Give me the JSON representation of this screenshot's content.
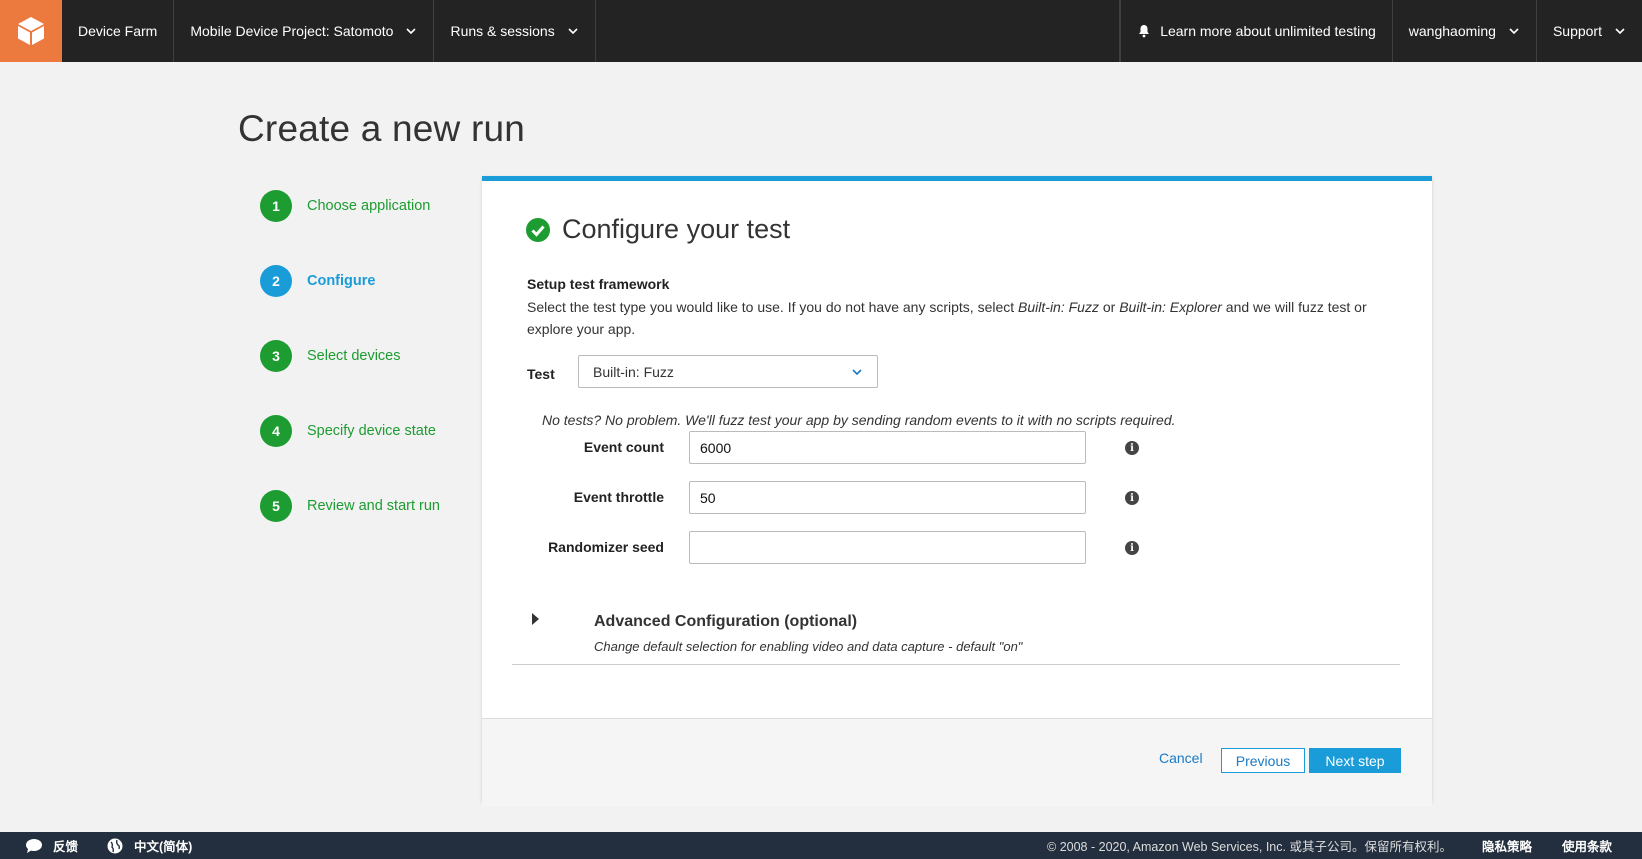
{
  "nav": {
    "brand": "Device Farm",
    "project": "Mobile Device Project: Satomoto",
    "runs": "Runs & sessions",
    "learn_more": "Learn more about unlimited testing",
    "user": "wanghaoming",
    "support": "Support",
    "logo_color": "#ec7a3f"
  },
  "page": {
    "title": "Create a new run"
  },
  "steps": [
    {
      "num": "1",
      "label": "Choose application",
      "state": "done"
    },
    {
      "num": "2",
      "label": "Configure",
      "state": "active"
    },
    {
      "num": "3",
      "label": "Select devices",
      "state": "done"
    },
    {
      "num": "4",
      "label": "Specify device state",
      "state": "done"
    },
    {
      "num": "5",
      "label": "Review and start run",
      "state": "done"
    }
  ],
  "card": {
    "title": "Configure your test",
    "setup_title": "Setup test framework",
    "setup_desc_1": "Select the test type you would like to use. If you do not have any scripts, select ",
    "setup_desc_fuzz": "Built-in: Fuzz",
    "setup_desc_or": " or ",
    "setup_desc_explorer": "Built-in: Explorer",
    "setup_desc_2": " and we will fuzz test or explore your app.",
    "test_label": "Test",
    "test_value": "Built-in: Fuzz",
    "fuzz_note": "No tests? No problem. We'll fuzz test your app by sending random events to it with no scripts required.",
    "fields": {
      "event_count": {
        "label": "Event count",
        "value": "6000"
      },
      "event_throttle": {
        "label": "Event throttle",
        "value": "50"
      },
      "randomizer_seed": {
        "label": "Randomizer seed",
        "value": ""
      }
    },
    "advanced_title": "Advanced Configuration (optional)",
    "advanced_sub": "Change default selection for enabling video and data capture - default \"on\"",
    "cancel": "Cancel",
    "previous": "Previous",
    "next": "Next step",
    "accent_color": "#1a9cd8",
    "success_color": "#1d9c31"
  },
  "footer": {
    "feedback": "反馈",
    "language": "中文(简体)",
    "copyright": "© 2008 - 2020, Amazon Web Services, Inc. 或其子公司。保留所有权利。",
    "privacy": "隐私策略",
    "terms": "使用条款"
  }
}
